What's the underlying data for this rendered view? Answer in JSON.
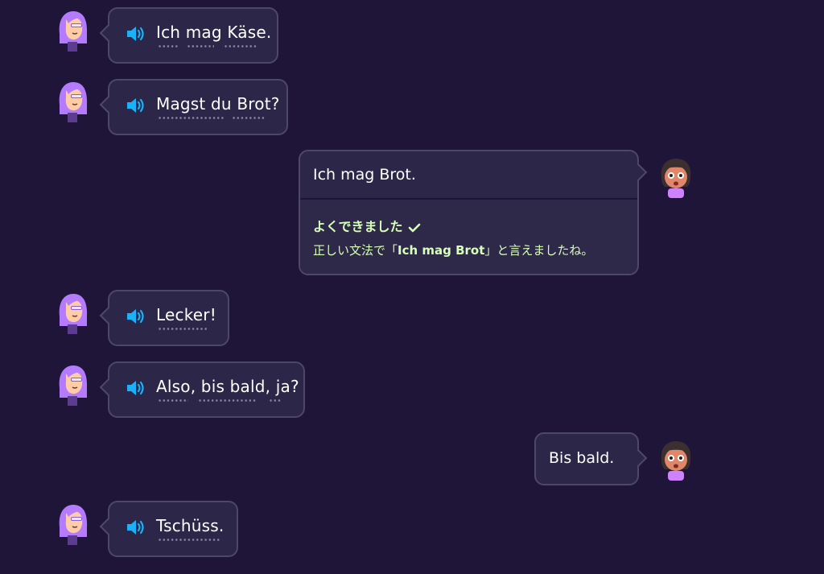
{
  "colors": {
    "background": "#1f1538",
    "bubble": "#2c2648",
    "bubble_border": "#4e4868",
    "speaker": "#1cb0f6",
    "feedback_text": "#d7ffb8"
  },
  "messages": [
    {
      "speaker": "partner",
      "text": "Ich mag Käse.",
      "icon": "speaker-icon"
    },
    {
      "speaker": "partner",
      "text": "Magst du Brot?",
      "icon": "speaker-icon"
    },
    {
      "speaker": "user",
      "text": "Ich mag Brot.",
      "feedback": {
        "title": "よくできました",
        "icon": "checkmark-icon",
        "body_prefix": "正しい文法で「",
        "body_phrase": "Ich mag Brot",
        "body_suffix": "」と言えましたね。"
      }
    },
    {
      "speaker": "partner",
      "text": "Lecker!",
      "icon": "speaker-icon"
    },
    {
      "speaker": "partner",
      "text": "Also, bis bald, ja?",
      "icon": "speaker-icon"
    },
    {
      "speaker": "user",
      "text": "Bis bald."
    },
    {
      "speaker": "partner",
      "text": "Tschüss.",
      "icon": "speaker-icon"
    }
  ]
}
